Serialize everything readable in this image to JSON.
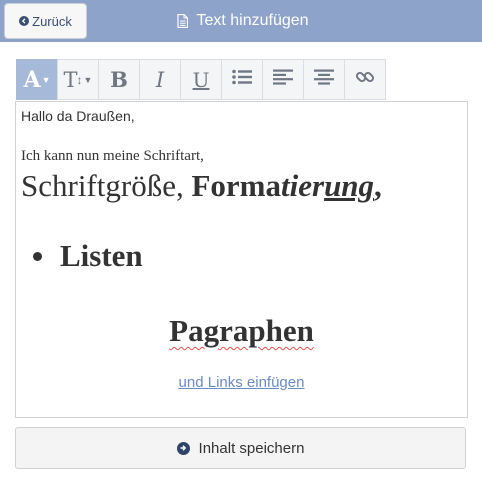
{
  "header": {
    "back_label": "Zurück",
    "title": "Text hinzufügen",
    "back_icon": "chevron-left-circle-icon",
    "title_icon": "document-icon",
    "background": "#8da3c9"
  },
  "toolbar": {
    "font_color_label": "A",
    "font_size_label": "T",
    "bold_label": "B",
    "italic_label": "I",
    "underline_label": "U",
    "icons": [
      "font-color-icon",
      "font-size-icon",
      "bold-icon",
      "italic-icon",
      "underline-icon",
      "bullet-list-icon",
      "align-left-icon",
      "align-center-icon",
      "link-icon"
    ],
    "active_color": "#a7b9d8"
  },
  "editor": {
    "line1": "Hallo da Draußen,",
    "line2": "Ich kann nun meine Schriftart,",
    "line3_plain": "Schriftgröße, ",
    "line3_bold": "Forma",
    "line3_bold_italic": "tier",
    "line3_underline": "ung",
    "line3_end": ",",
    "bullet_item": "Listen",
    "paragraph": "Pagraphen",
    "link_text": "und Links einfügen"
  },
  "save": {
    "label": "Inhalt speichern",
    "icon": "arrow-right-circle-icon"
  }
}
